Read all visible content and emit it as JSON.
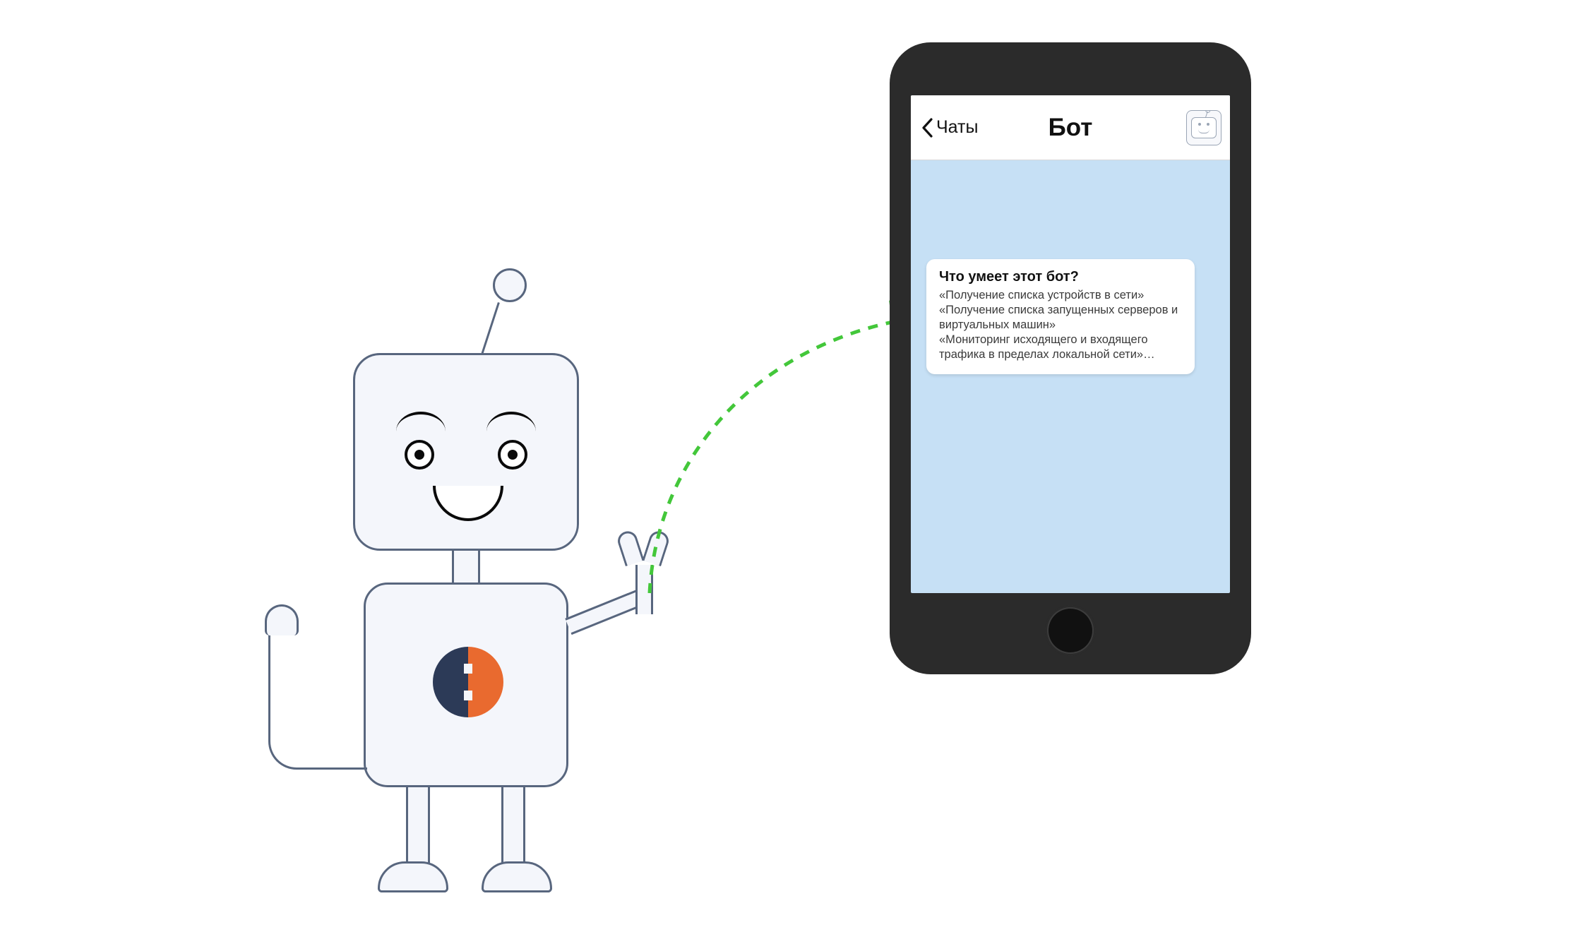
{
  "phone": {
    "back_label": "Чаты",
    "title": "Бот"
  },
  "message": {
    "title": "Что умеет этот бот?",
    "lines": [
      "«Получение списка устройств в сети»",
      "«Получение списка запущенных серверов и виртуальных машин»",
      "«Мониторинг исходящего и входящего трафика в пределах локальной сети»…"
    ]
  },
  "colors": {
    "arrow": "#43c73a",
    "phone_body": "#2b2b2b",
    "screen_bg": "#c6e0f5",
    "emblem_left": "#2c3a57",
    "emblem_right": "#e96a2f"
  }
}
